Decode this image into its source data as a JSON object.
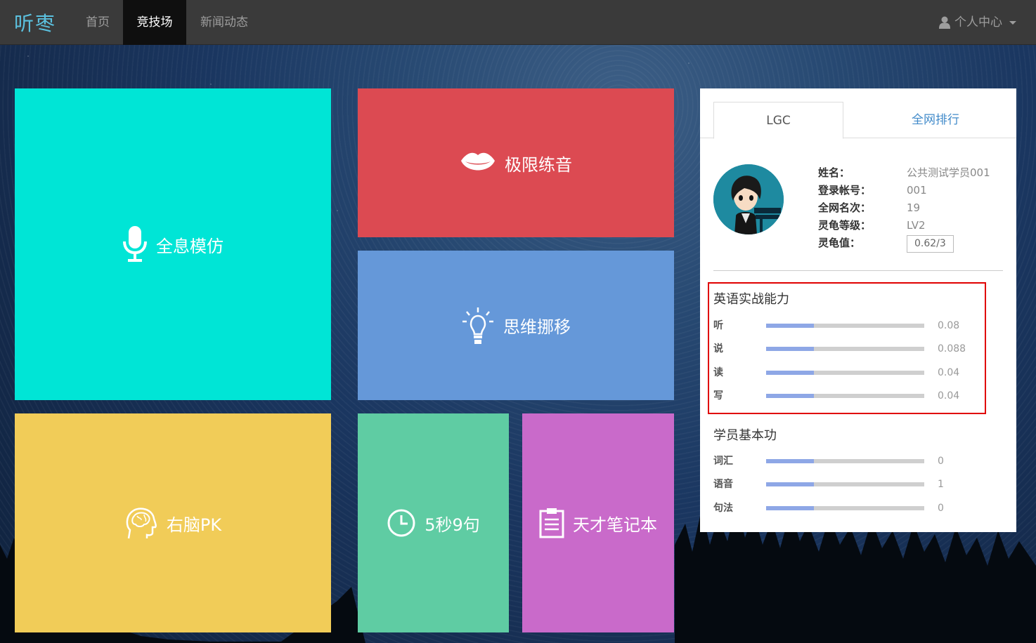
{
  "navbar": {
    "brand": "听枣",
    "items": [
      {
        "label": "首页",
        "active": false
      },
      {
        "label": "竞技场",
        "active": true
      },
      {
        "label": "新闻动态",
        "active": false
      }
    ],
    "user_menu": "个人中心"
  },
  "tiles": [
    {
      "label": "全息模仿",
      "icon": "microphone-icon",
      "color": "#00e5d6"
    },
    {
      "label": "极限练音",
      "icon": "lips-icon",
      "color": "#dc4a52"
    },
    {
      "label": "思维挪移",
      "icon": "lightbulb-icon",
      "color": "#6598d9"
    },
    {
      "label": "右脑PK",
      "icon": "brain-head-icon",
      "color": "#f1cc58"
    },
    {
      "label": "5秒9句",
      "icon": "clock-icon",
      "color": "#5fcca3"
    },
    {
      "label": "天才笔记本",
      "icon": "clipboard-icon",
      "color": "#c96aca"
    }
  ],
  "panel": {
    "tabs": [
      "LGC",
      "全网排行"
    ],
    "profile": {
      "labels": [
        "姓名：",
        "登录帐号：",
        "全网名次：",
        "灵龟等级：",
        "灵龟值："
      ],
      "values": [
        "公共测试学员001",
        "001",
        "19",
        "LV2",
        "0.62/3"
      ]
    },
    "english_ability": {
      "title": "英语实战能力",
      "skills": [
        {
          "name": "听",
          "value": "0.08",
          "progress": 0.3
        },
        {
          "name": "说",
          "value": "0.088",
          "progress": 0.3
        },
        {
          "name": "读",
          "value": "0.04",
          "progress": 0.3
        },
        {
          "name": "写",
          "value": "0.04",
          "progress": 0.3
        }
      ]
    },
    "basics": {
      "title": "学员基本功",
      "skills": [
        {
          "name": "词汇",
          "value": "0",
          "progress": 0.3
        },
        {
          "name": "语音",
          "value": "1",
          "progress": 0.3
        },
        {
          "name": "句法",
          "value": "0",
          "progress": 0.3
        }
      ]
    }
  }
}
